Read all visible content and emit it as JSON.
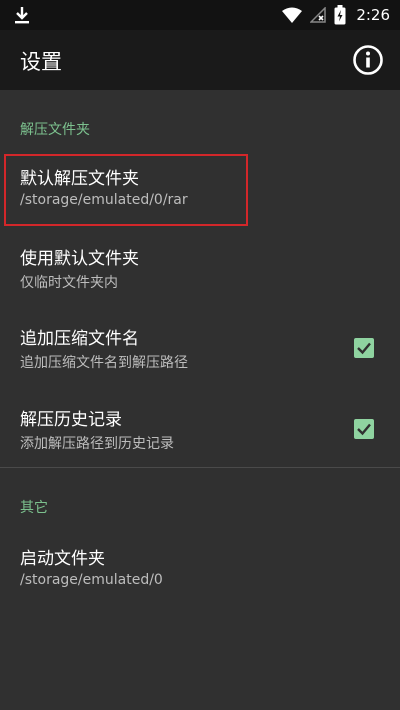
{
  "status_bar": {
    "time": "2:26",
    "icons": [
      "download-icon",
      "wifi-icon",
      "no-signal-icon",
      "battery-charging-icon"
    ]
  },
  "app_bar": {
    "title": "设置",
    "info_icon": "info-icon"
  },
  "sections": [
    {
      "header": "解压文件夹",
      "items": [
        {
          "title": "默认解压文件夹",
          "summary": "/storage/emulated/0/rar",
          "highlighted": true
        },
        {
          "title": "使用默认文件夹",
          "summary": "仅临时文件夹内"
        },
        {
          "title": "追加压缩文件名",
          "summary": "追加压缩文件名到解压路径",
          "checked": true
        },
        {
          "title": "解压历史记录",
          "summary": "添加解压路径到历史记录",
          "checked": true
        }
      ]
    },
    {
      "header": "其它",
      "items": [
        {
          "title": "启动文件夹",
          "summary": "/storage/emulated/0"
        }
      ]
    }
  ],
  "colors": {
    "background": "#303030",
    "app_bar": "#1a1a1a",
    "status_bar": "#121212",
    "section_header": "#7cc18e",
    "checkbox": "#8fd3a0",
    "highlight": "#d3272a"
  }
}
